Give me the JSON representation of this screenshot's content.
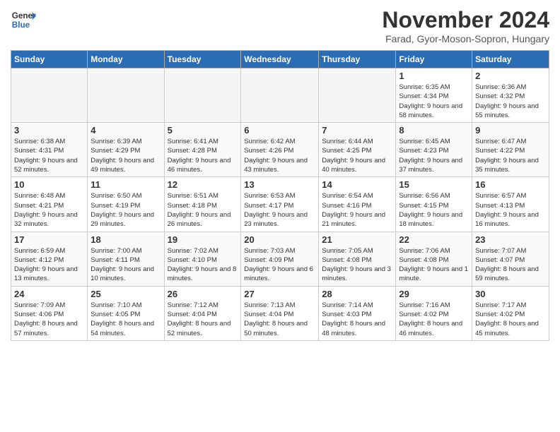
{
  "header": {
    "logo_line1": "General",
    "logo_line2": "Blue",
    "month_year": "November 2024",
    "location": "Farad, Gyor-Moson-Sopron, Hungary"
  },
  "weekdays": [
    "Sunday",
    "Monday",
    "Tuesday",
    "Wednesday",
    "Thursday",
    "Friday",
    "Saturday"
  ],
  "weeks": [
    [
      {
        "day": "",
        "info": ""
      },
      {
        "day": "",
        "info": ""
      },
      {
        "day": "",
        "info": ""
      },
      {
        "day": "",
        "info": ""
      },
      {
        "day": "",
        "info": ""
      },
      {
        "day": "1",
        "info": "Sunrise: 6:35 AM\nSunset: 4:34 PM\nDaylight: 9 hours and 58 minutes."
      },
      {
        "day": "2",
        "info": "Sunrise: 6:36 AM\nSunset: 4:32 PM\nDaylight: 9 hours and 55 minutes."
      }
    ],
    [
      {
        "day": "3",
        "info": "Sunrise: 6:38 AM\nSunset: 4:31 PM\nDaylight: 9 hours and 52 minutes."
      },
      {
        "day": "4",
        "info": "Sunrise: 6:39 AM\nSunset: 4:29 PM\nDaylight: 9 hours and 49 minutes."
      },
      {
        "day": "5",
        "info": "Sunrise: 6:41 AM\nSunset: 4:28 PM\nDaylight: 9 hours and 46 minutes."
      },
      {
        "day": "6",
        "info": "Sunrise: 6:42 AM\nSunset: 4:26 PM\nDaylight: 9 hours and 43 minutes."
      },
      {
        "day": "7",
        "info": "Sunrise: 6:44 AM\nSunset: 4:25 PM\nDaylight: 9 hours and 40 minutes."
      },
      {
        "day": "8",
        "info": "Sunrise: 6:45 AM\nSunset: 4:23 PM\nDaylight: 9 hours and 37 minutes."
      },
      {
        "day": "9",
        "info": "Sunrise: 6:47 AM\nSunset: 4:22 PM\nDaylight: 9 hours and 35 minutes."
      }
    ],
    [
      {
        "day": "10",
        "info": "Sunrise: 6:48 AM\nSunset: 4:21 PM\nDaylight: 9 hours and 32 minutes."
      },
      {
        "day": "11",
        "info": "Sunrise: 6:50 AM\nSunset: 4:19 PM\nDaylight: 9 hours and 29 minutes."
      },
      {
        "day": "12",
        "info": "Sunrise: 6:51 AM\nSunset: 4:18 PM\nDaylight: 9 hours and 26 minutes."
      },
      {
        "day": "13",
        "info": "Sunrise: 6:53 AM\nSunset: 4:17 PM\nDaylight: 9 hours and 23 minutes."
      },
      {
        "day": "14",
        "info": "Sunrise: 6:54 AM\nSunset: 4:16 PM\nDaylight: 9 hours and 21 minutes."
      },
      {
        "day": "15",
        "info": "Sunrise: 6:56 AM\nSunset: 4:15 PM\nDaylight: 9 hours and 18 minutes."
      },
      {
        "day": "16",
        "info": "Sunrise: 6:57 AM\nSunset: 4:13 PM\nDaylight: 9 hours and 16 minutes."
      }
    ],
    [
      {
        "day": "17",
        "info": "Sunrise: 6:59 AM\nSunset: 4:12 PM\nDaylight: 9 hours and 13 minutes."
      },
      {
        "day": "18",
        "info": "Sunrise: 7:00 AM\nSunset: 4:11 PM\nDaylight: 9 hours and 10 minutes."
      },
      {
        "day": "19",
        "info": "Sunrise: 7:02 AM\nSunset: 4:10 PM\nDaylight: 9 hours and 8 minutes."
      },
      {
        "day": "20",
        "info": "Sunrise: 7:03 AM\nSunset: 4:09 PM\nDaylight: 9 hours and 6 minutes."
      },
      {
        "day": "21",
        "info": "Sunrise: 7:05 AM\nSunset: 4:08 PM\nDaylight: 9 hours and 3 minutes."
      },
      {
        "day": "22",
        "info": "Sunrise: 7:06 AM\nSunset: 4:08 PM\nDaylight: 9 hours and 1 minute."
      },
      {
        "day": "23",
        "info": "Sunrise: 7:07 AM\nSunset: 4:07 PM\nDaylight: 8 hours and 59 minutes."
      }
    ],
    [
      {
        "day": "24",
        "info": "Sunrise: 7:09 AM\nSunset: 4:06 PM\nDaylight: 8 hours and 57 minutes."
      },
      {
        "day": "25",
        "info": "Sunrise: 7:10 AM\nSunset: 4:05 PM\nDaylight: 8 hours and 54 minutes."
      },
      {
        "day": "26",
        "info": "Sunrise: 7:12 AM\nSunset: 4:04 PM\nDaylight: 8 hours and 52 minutes."
      },
      {
        "day": "27",
        "info": "Sunrise: 7:13 AM\nSunset: 4:04 PM\nDaylight: 8 hours and 50 minutes."
      },
      {
        "day": "28",
        "info": "Sunrise: 7:14 AM\nSunset: 4:03 PM\nDaylight: 8 hours and 48 minutes."
      },
      {
        "day": "29",
        "info": "Sunrise: 7:16 AM\nSunset: 4:02 PM\nDaylight: 8 hours and 46 minutes."
      },
      {
        "day": "30",
        "info": "Sunrise: 7:17 AM\nSunset: 4:02 PM\nDaylight: 8 hours and 45 minutes."
      }
    ]
  ]
}
